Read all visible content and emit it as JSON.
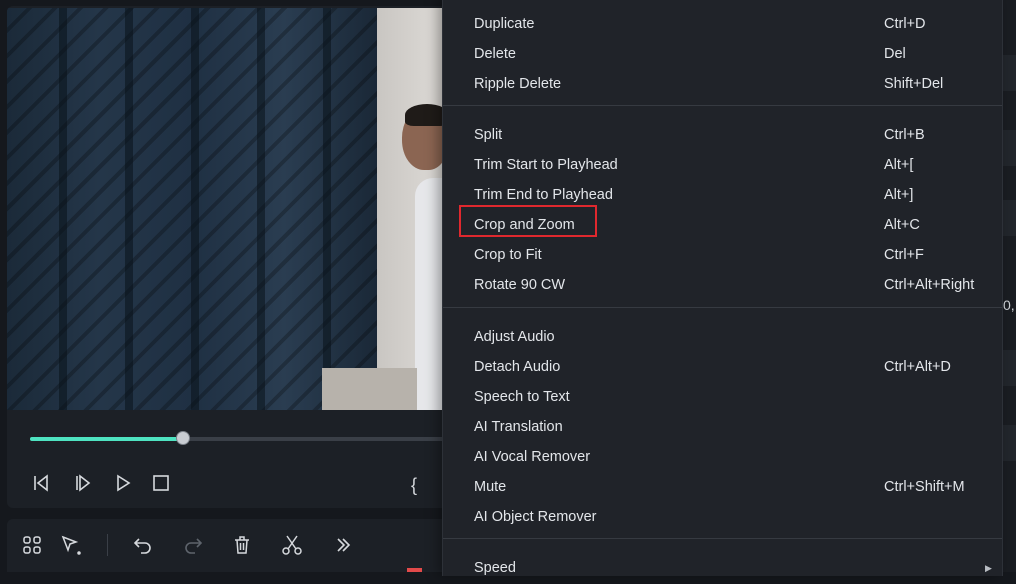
{
  "menu": {
    "groups": [
      [
        {
          "label": "Duplicate",
          "shortcut": "Ctrl+D"
        },
        {
          "label": "Delete",
          "shortcut": "Del"
        },
        {
          "label": "Ripple Delete",
          "shortcut": "Shift+Del"
        }
      ],
      [
        {
          "label": "Split",
          "shortcut": "Ctrl+B"
        },
        {
          "label": "Trim Start to Playhead",
          "shortcut": "Alt+["
        },
        {
          "label": "Trim End to Playhead",
          "shortcut": "Alt+]"
        },
        {
          "label": "Crop and Zoom",
          "shortcut": "Alt+C"
        },
        {
          "label": "Crop to Fit",
          "shortcut": "Ctrl+F"
        },
        {
          "label": "Rotate 90 CW",
          "shortcut": "Ctrl+Alt+Right"
        }
      ],
      [
        {
          "label": "Adjust Audio",
          "shortcut": ""
        },
        {
          "label": "Detach Audio",
          "shortcut": "Ctrl+Alt+D"
        },
        {
          "label": "Speech to Text",
          "shortcut": ""
        },
        {
          "label": "AI Translation",
          "shortcut": ""
        },
        {
          "label": "AI Vocal Remover",
          "shortcut": ""
        },
        {
          "label": "Mute",
          "shortcut": "Ctrl+Shift+M"
        },
        {
          "label": "AI Object Remover",
          "shortcut": ""
        }
      ],
      [
        {
          "label": "Speed",
          "shortcut": "",
          "submenu": true
        }
      ]
    ],
    "highlighted_item": "Crop and Zoom",
    "highlight_color": "#e0282e"
  },
  "player": {
    "progress": 0.34,
    "accent_color": "#4ee3c1",
    "controls": [
      {
        "name": "prev-frame-icon"
      },
      {
        "name": "next-frame-icon"
      },
      {
        "name": "play-icon"
      },
      {
        "name": "stop-icon"
      }
    ],
    "mark_glyph": "{"
  },
  "toolbar": {
    "tools": [
      {
        "name": "layout-grid-icon",
        "enabled": true
      },
      {
        "name": "select-pointer-icon",
        "enabled": true
      },
      {
        "name": "undo-icon",
        "enabled": true
      },
      {
        "name": "redo-icon",
        "enabled": false
      },
      {
        "name": "delete-trash-icon",
        "enabled": true
      },
      {
        "name": "split-scissors-icon",
        "enabled": true
      },
      {
        "name": "more-chevrons-icon",
        "enabled": true
      }
    ]
  },
  "right_panel": {
    "edge_text": "0,"
  }
}
